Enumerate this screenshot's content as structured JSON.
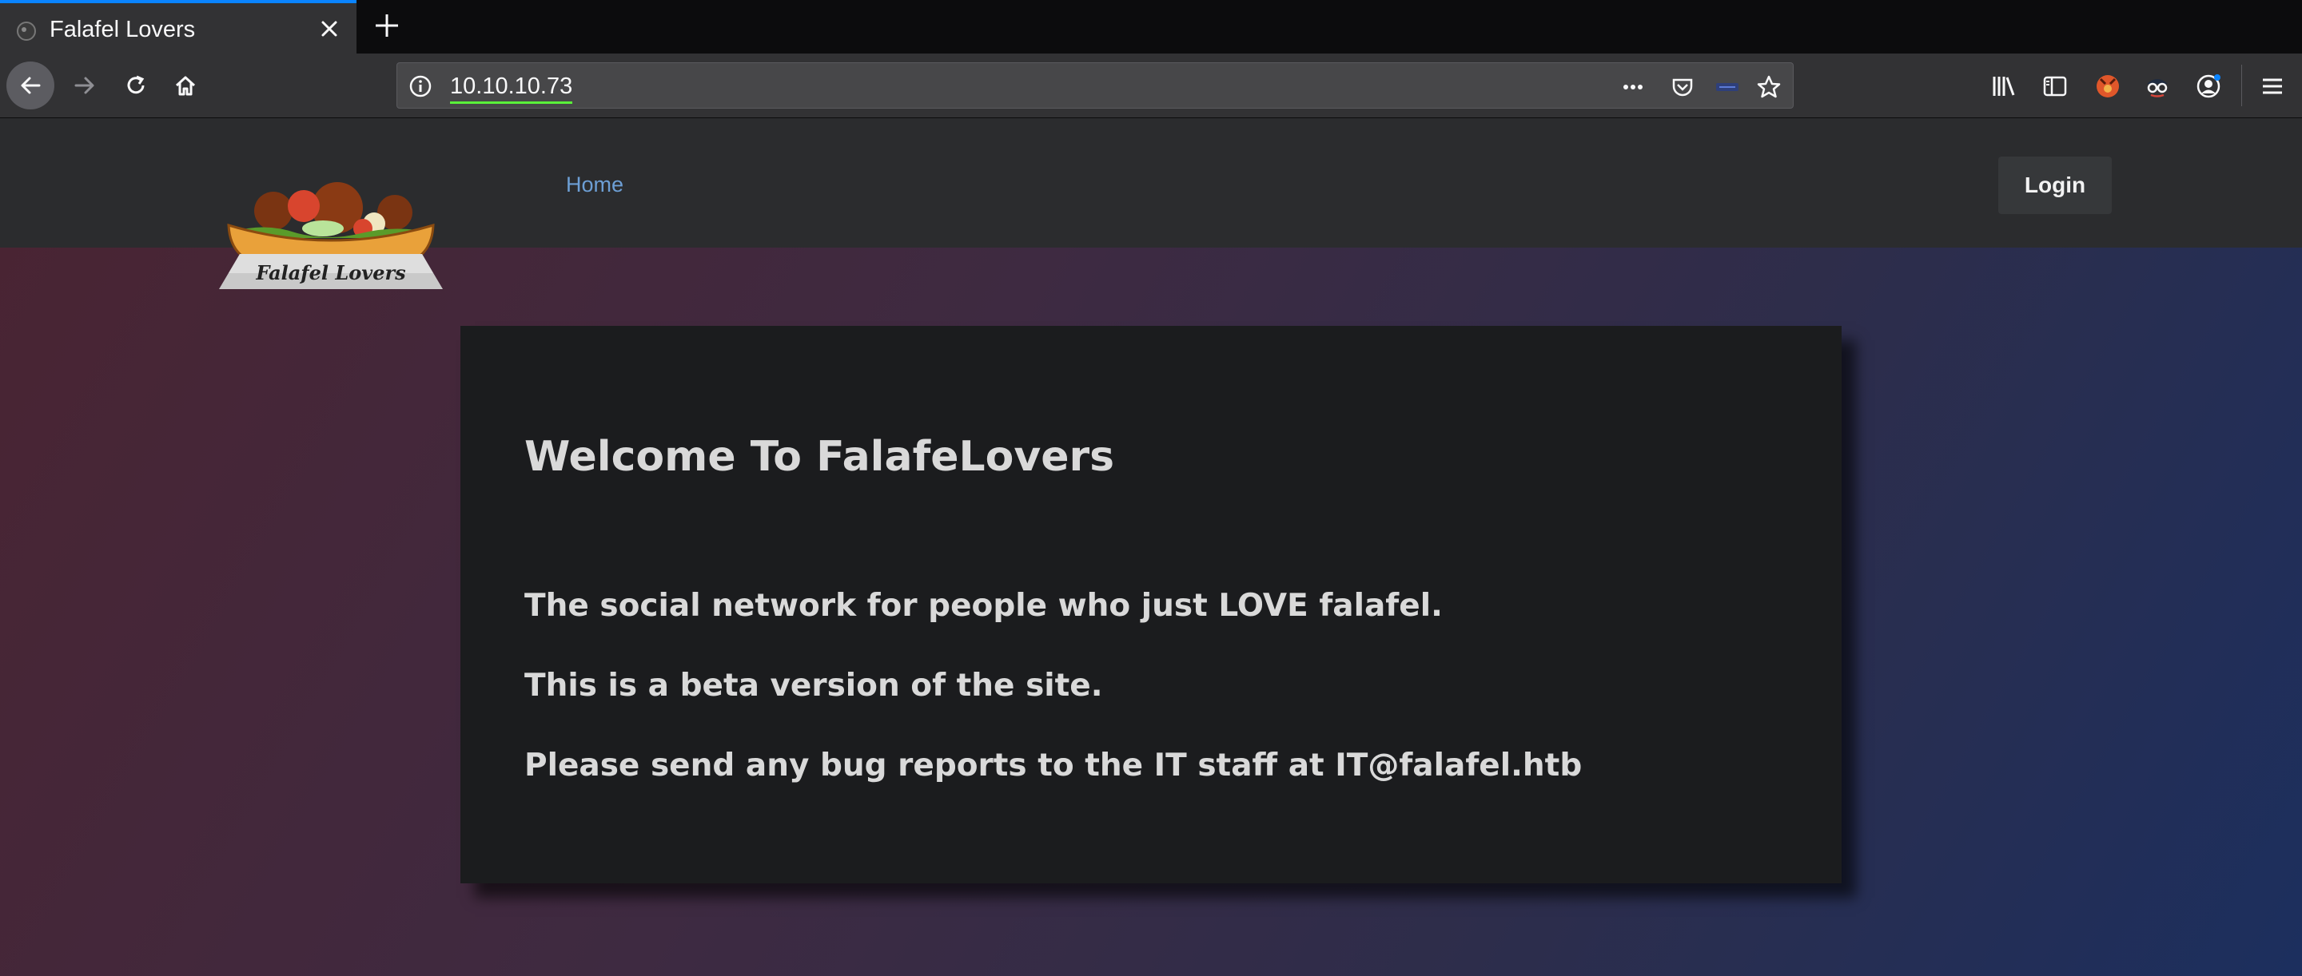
{
  "browser": {
    "tab": {
      "title": "Falafel Lovers"
    },
    "address": {
      "url": "10.10.10.73"
    }
  },
  "site": {
    "logo_text": "Falafel Lovers",
    "nav": {
      "home": "Home"
    },
    "login_label": "Login"
  },
  "card": {
    "title": "Welcome To FalafeLovers",
    "lines": [
      "The social network for people who just LOVE falafel.",
      "This is a beta version of the site.",
      "Please send any bug reports to the IT staff at IT@falafel.htb"
    ]
  },
  "colors": {
    "tab_accent": "#0a84ff",
    "url_underline": "#5af03a",
    "nav_link": "#6d9fd5",
    "card_bg": "#1b1c1e",
    "card_text": "#d9d9d9"
  }
}
